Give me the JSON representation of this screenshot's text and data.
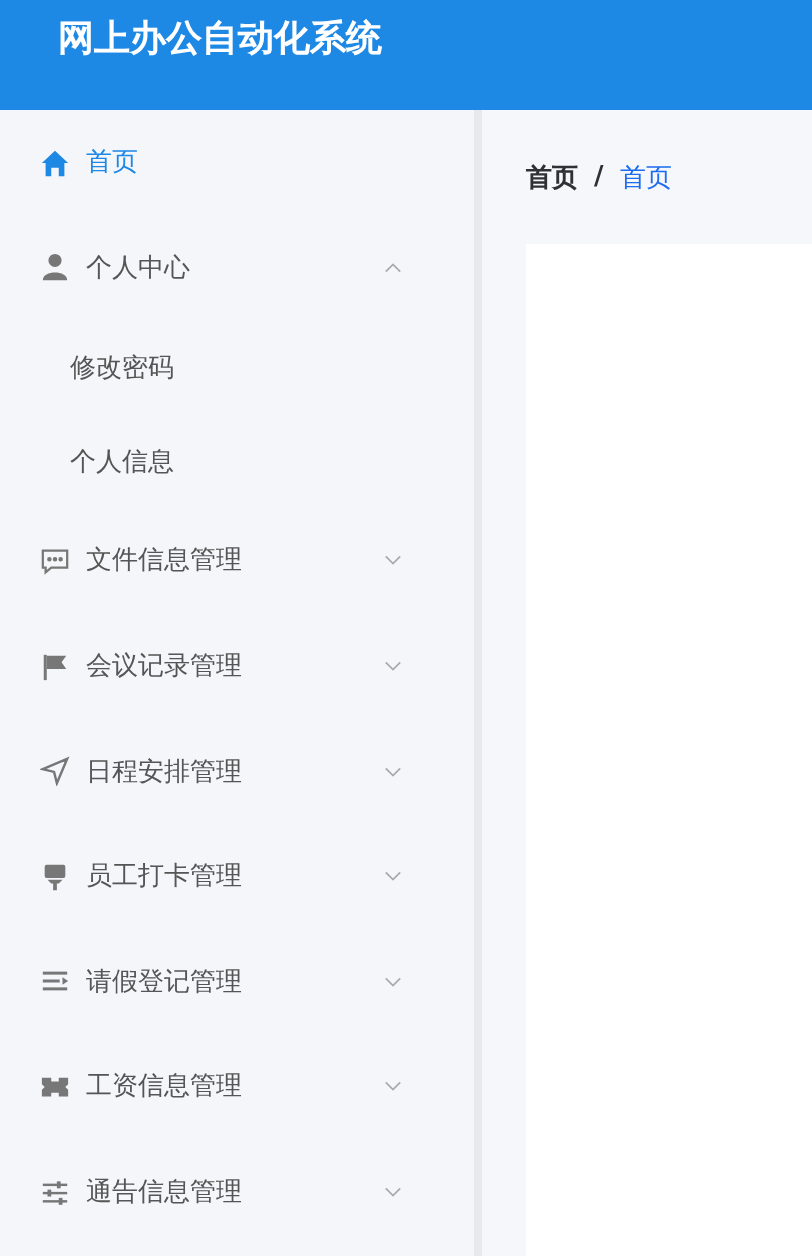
{
  "header": {
    "title": "网上办公自动化系统"
  },
  "menu": [
    {
      "label": "首页",
      "kind": "item",
      "selected": true
    },
    {
      "label": "个人中心",
      "kind": "submenu",
      "selected": false,
      "expanded": true,
      "children": [
        {
          "label": "修改密码",
          "selected": false
        },
        {
          "label": "个人信息",
          "selected": false
        }
      ]
    },
    {
      "label": "文件信息管理",
      "kind": "submenu",
      "selected": false,
      "expanded": false
    },
    {
      "label": "会议记录管理",
      "kind": "submenu",
      "selected": false,
      "expanded": false
    },
    {
      "label": "日程安排管理",
      "kind": "submenu",
      "selected": false,
      "expanded": false
    },
    {
      "label": "员工打卡管理",
      "kind": "submenu",
      "selected": false,
      "expanded": false
    },
    {
      "label": "请假登记管理",
      "kind": "submenu",
      "selected": false,
      "expanded": false
    },
    {
      "label": "工资信息管理",
      "kind": "submenu",
      "selected": false,
      "expanded": false
    },
    {
      "label": "通告信息管理",
      "kind": "submenu",
      "selected": false,
      "expanded": false
    }
  ],
  "breadcrumb": {
    "separator": "/",
    "items": [
      {
        "label": "首页",
        "current": false
      },
      {
        "label": "首页",
        "current": true
      }
    ]
  }
}
